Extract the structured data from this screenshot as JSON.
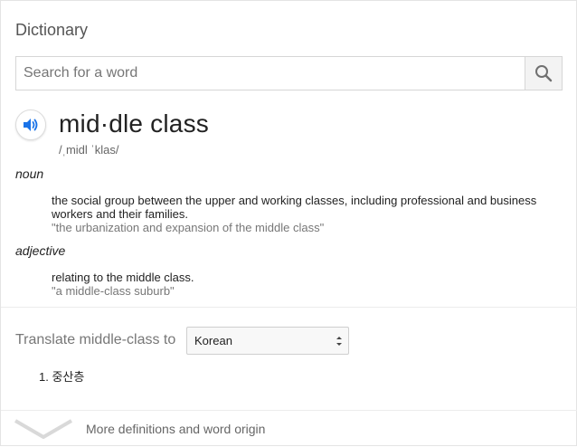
{
  "dictionary": {
    "title": "Dictionary",
    "search": {
      "placeholder": "Search for a word",
      "value": ""
    },
    "icons": {
      "search": "search-icon",
      "speaker": "speaker-icon",
      "chevron": "chevron-down-icon"
    },
    "entry": {
      "headword": "mid·dle class",
      "phonetic": "/ˌmidl ˈklas/",
      "senses": [
        {
          "part_of_speech": "noun",
          "definition": "the social group between the upper and working classes, including professional and business workers and their families.",
          "example": "\"the urbanization and expansion of the middle class\""
        },
        {
          "part_of_speech": "adjective",
          "definition": "relating to the middle class.",
          "example": "\"a middle-class suburb\""
        }
      ]
    },
    "translate": {
      "label": "Translate middle-class to",
      "selected_language": "Korean",
      "results": [
        "1. 중산층"
      ]
    },
    "more_link": "More definitions and word origin",
    "colors": {
      "accent_blue": "#1a73e8",
      "muted_text": "#777777",
      "border": "#d6d6d6"
    }
  }
}
